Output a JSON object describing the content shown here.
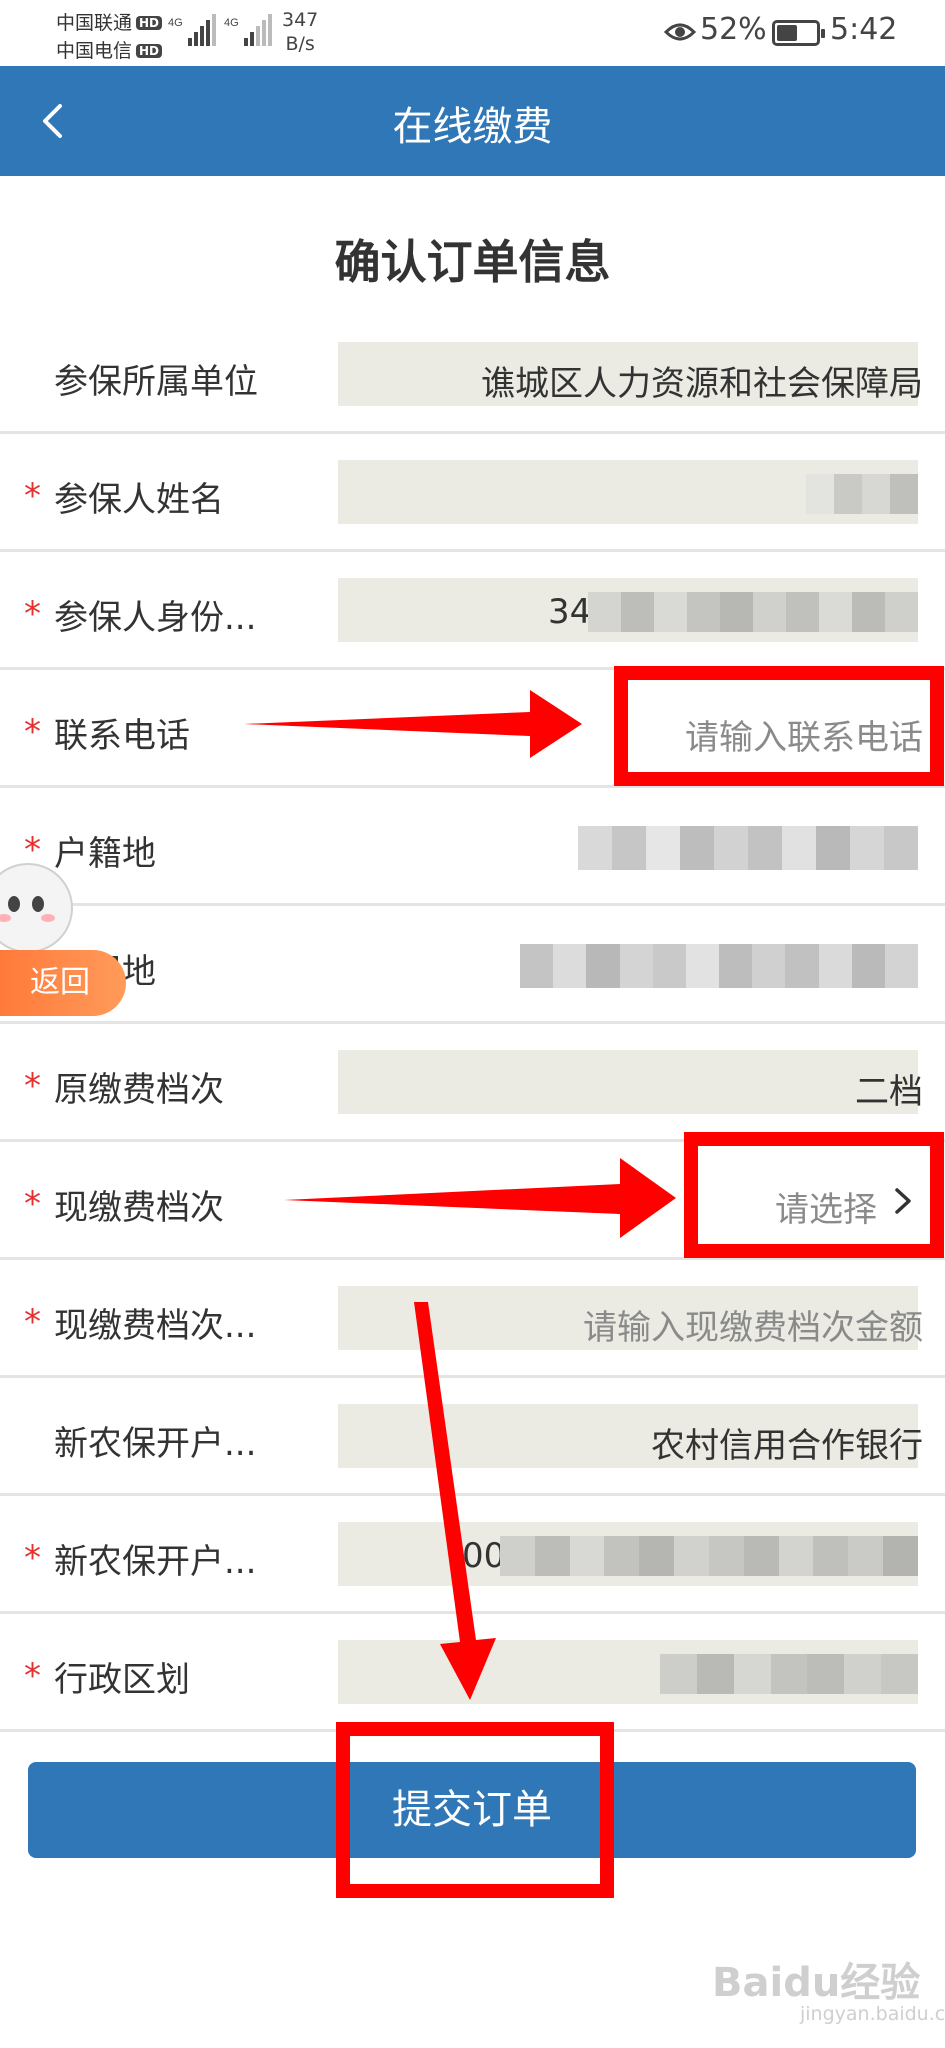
{
  "status_bar": {
    "carrier1": "中国联通",
    "carrier2": "中国电信",
    "hd_badge": "HD",
    "net1": "4G",
    "net2": "4G",
    "speed_value": "347",
    "speed_unit": "B/s",
    "battery_percent": "52%",
    "battery_level": 0.52,
    "time": "5:42"
  },
  "title_bar": {
    "title": "在线缴费",
    "back_icon": "chevron-left-icon"
  },
  "page_heading": "确认订单信息",
  "form_rows": [
    {
      "label": "参保所属单位",
      "required": false,
      "value": "谯城区人力资源和社会保障局"
    },
    {
      "label": "参保人姓名",
      "required": true,
      "value": ""
    },
    {
      "label": "参保人身份...",
      "required": true,
      "value": "34"
    },
    {
      "label": "联系电话",
      "required": true,
      "placeholder": "请输入联系电话"
    },
    {
      "label": "户籍地",
      "required": true,
      "value": ""
    },
    {
      "label": "现居地",
      "required": true,
      "value": ""
    },
    {
      "label": "原缴费档次",
      "required": true,
      "value": "二档"
    },
    {
      "label": "现缴费档次",
      "required": true,
      "placeholder": "请选择"
    },
    {
      "label": "现缴费档次...",
      "required": true,
      "placeholder": "请输入现缴费档次金额"
    },
    {
      "label": "新农保开户...",
      "required": false,
      "value": "农村信用合作银行"
    },
    {
      "label": "新农保开户...",
      "required": true,
      "value": "00"
    },
    {
      "label": "行政区划",
      "required": true,
      "value": ""
    }
  ],
  "required_mark": "*",
  "submit_label": "提交订单",
  "float_back_label": "返回",
  "watermark": {
    "brand": "Baidu经验",
    "url": "jingyan.baidu.com"
  },
  "colors": {
    "primary": "#2f77b6",
    "required": "#e53030",
    "annotation": "#ff0000",
    "float_button": "#ff7a3a"
  }
}
